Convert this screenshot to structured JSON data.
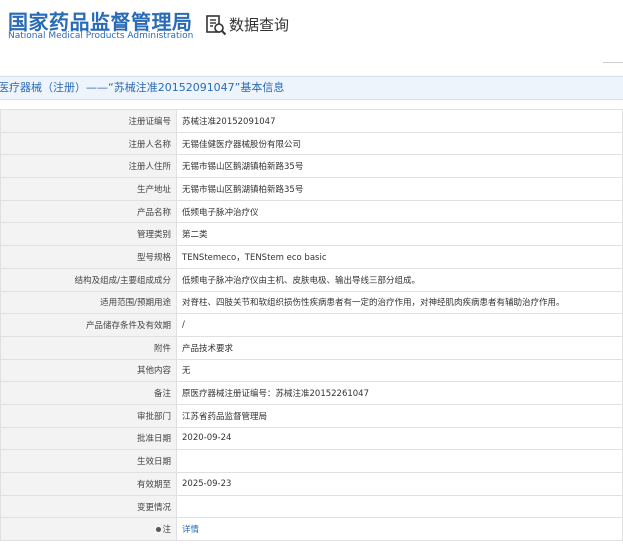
{
  "header": {
    "logo_cn": "国家药品监督管理局",
    "logo_en": "National Medical Products Administration",
    "query_label": "数据查询",
    "query_icon": "document-search-icon"
  },
  "title_bar": {
    "text": "医疗器械（注册）——“苏械注准20152091047”基本信息"
  },
  "rows": [
    {
      "label": "注册证编号",
      "value": "苏械注准20152091047"
    },
    {
      "label": "注册人名称",
      "value": "无锡佳健医疗器械股份有限公司"
    },
    {
      "label": "注册人住所",
      "value": "无锡市锡山区鹅湖镇柏新路35号"
    },
    {
      "label": "生产地址",
      "value": "无锡市锡山区鹅湖镇柏新路35号"
    },
    {
      "label": "产品名称",
      "value": "低频电子脉冲治疗仪"
    },
    {
      "label": "管理类别",
      "value": "第二类"
    },
    {
      "label": "型号规格",
      "value": "TENStemeco，TENStem eco basic"
    },
    {
      "label": "结构及组成/主要组成成分",
      "value": "低频电子脉冲治疗仪由主机、皮肤电极、输出导线三部分组成。"
    },
    {
      "label": "适用范围/预期用途",
      "value": "对脊柱、四肢关节和软组织损伤性疾病患者有一定的治疗作用，对神经肌肉疾病患者有辅助治疗作用。"
    },
    {
      "label": "产品储存条件及有效期",
      "value": "/"
    },
    {
      "label": "附件",
      "value": "产品技术要求"
    },
    {
      "label": "其他内容",
      "value": "无"
    },
    {
      "label": "备注",
      "value": "原医疗器械注册证编号：苏械注准20152261047"
    },
    {
      "label": "审批部门",
      "value": "江苏省药品监督管理局"
    },
    {
      "label": "批准日期",
      "value": "2020-09-24"
    },
    {
      "label": "生效日期",
      "value": ""
    },
    {
      "label": "有效期至",
      "value": "2025-09-23"
    },
    {
      "label": "变更情况",
      "value": ""
    },
    {
      "label": "注",
      "value": "详情"
    }
  ],
  "colors": {
    "brand_blue": "#2a6bb7",
    "label_bg": "#f3f3f3",
    "title_bar_bg": "#eef4fb"
  }
}
